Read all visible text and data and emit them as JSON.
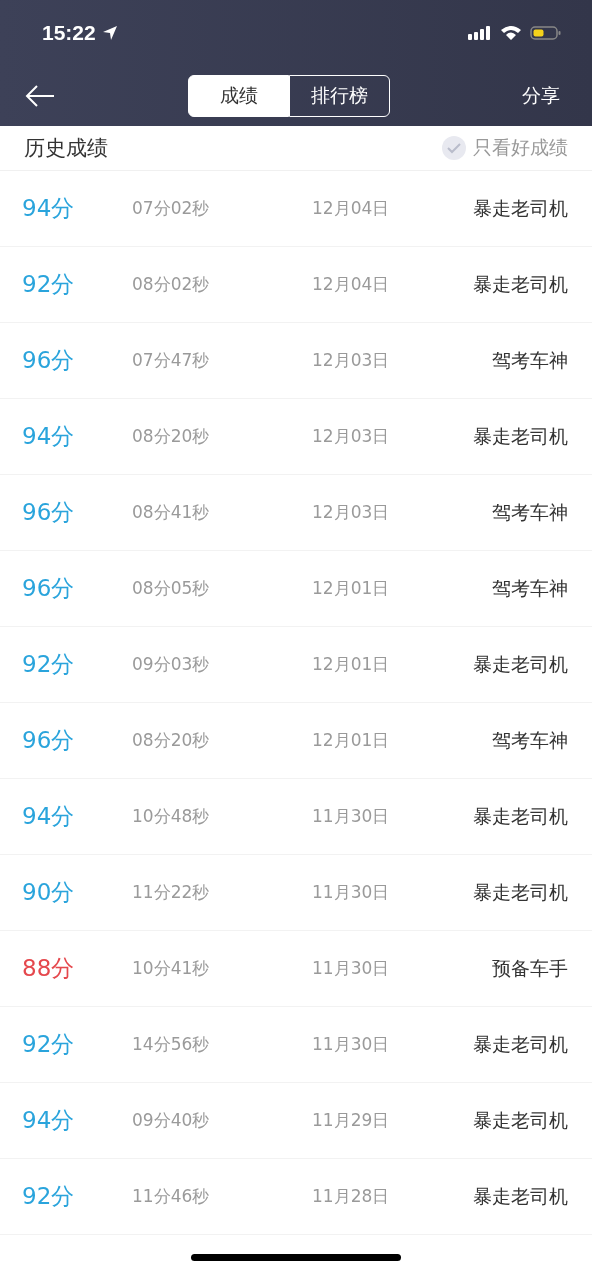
{
  "status_bar": {
    "time": "15:22"
  },
  "nav": {
    "tabs": [
      {
        "label": "成绩",
        "selected": true
      },
      {
        "label": "排行榜",
        "selected": false
      }
    ],
    "share": "分享"
  },
  "history": {
    "title": "历史成绩",
    "filter": {
      "label": "只看好成绩",
      "checked": false
    },
    "rows": [
      {
        "score": "94分",
        "color": "#2aa4dc",
        "time": "07分02秒",
        "date": "12月04日",
        "rank": "暴走老司机"
      },
      {
        "score": "92分",
        "color": "#2aa4dc",
        "time": "08分02秒",
        "date": "12月04日",
        "rank": "暴走老司机"
      },
      {
        "score": "96分",
        "color": "#2aa4dc",
        "time": "07分47秒",
        "date": "12月03日",
        "rank": "驾考车神"
      },
      {
        "score": "94分",
        "color": "#2aa4dc",
        "time": "08分20秒",
        "date": "12月03日",
        "rank": "暴走老司机"
      },
      {
        "score": "96分",
        "color": "#2aa4dc",
        "time": "08分41秒",
        "date": "12月03日",
        "rank": "驾考车神"
      },
      {
        "score": "96分",
        "color": "#2aa4dc",
        "time": "08分05秒",
        "date": "12月01日",
        "rank": "驾考车神"
      },
      {
        "score": "92分",
        "color": "#2aa4dc",
        "time": "09分03秒",
        "date": "12月01日",
        "rank": "暴走老司机"
      },
      {
        "score": "96分",
        "color": "#2aa4dc",
        "time": "08分20秒",
        "date": "12月01日",
        "rank": "驾考车神"
      },
      {
        "score": "94分",
        "color": "#2aa4dc",
        "time": "10分48秒",
        "date": "11月30日",
        "rank": "暴走老司机"
      },
      {
        "score": "90分",
        "color": "#2aa4dc",
        "time": "11分22秒",
        "date": "11月30日",
        "rank": "暴走老司机"
      },
      {
        "score": "88分",
        "color": "#e5484d",
        "time": "10分41秒",
        "date": "11月30日",
        "rank": "预备车手"
      },
      {
        "score": "92分",
        "color": "#2aa4dc",
        "time": "14分56秒",
        "date": "11月30日",
        "rank": "暴走老司机"
      },
      {
        "score": "94分",
        "color": "#2aa4dc",
        "time": "09分40秒",
        "date": "11月29日",
        "rank": "暴走老司机"
      },
      {
        "score": "92分",
        "color": "#2aa4dc",
        "time": "11分46秒",
        "date": "11月28日",
        "rank": "暴走老司机"
      }
    ]
  }
}
